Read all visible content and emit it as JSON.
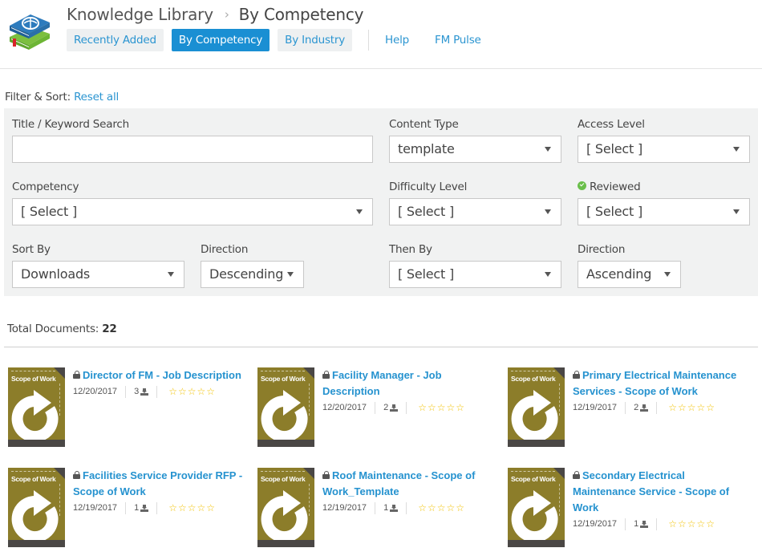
{
  "header": {
    "breadcrumb": [
      "Knowledge Library",
      "By Competency"
    ],
    "breadcrumb_separator": "›",
    "nav_tabs": [
      {
        "label": "Recently Added",
        "active": false
      },
      {
        "label": "By Competency",
        "active": true
      },
      {
        "label": "By Industry",
        "active": false
      }
    ],
    "nav_links": [
      "Help",
      "FM Pulse"
    ]
  },
  "filter": {
    "heading": "Filter & Sort:",
    "reset_label": "Reset all",
    "title_search": {
      "label": "Title / Keyword Search",
      "value": "",
      "placeholder": ""
    },
    "content_type": {
      "label": "Content Type",
      "value": "template"
    },
    "access_level": {
      "label": "Access Level",
      "value": "[ Select ]"
    },
    "competency": {
      "label": "Competency",
      "value": "[ Select ]"
    },
    "difficulty_level": {
      "label": "Difficulty Level",
      "value": "[ Select ]"
    },
    "reviewed": {
      "label": "Reviewed",
      "value": "[ Select ]"
    },
    "sort_by": {
      "label": "Sort By",
      "value": "Downloads"
    },
    "sort_direction": {
      "label": "Direction",
      "value": "Descending"
    },
    "then_by": {
      "label": "Then By",
      "value": "[ Select ]"
    },
    "then_direction": {
      "label": "Direction",
      "value": "Ascending"
    }
  },
  "results": {
    "total_label": "Total Documents:",
    "total_count": "22",
    "thumbnail_label": "Scope of Work",
    "documents": [
      {
        "title": "Director of FM - Job Description",
        "date": "12/20/2017",
        "downloads": "3",
        "rating": 0,
        "locked": true
      },
      {
        "title": "Facility Manager - Job Description",
        "date": "12/20/2017",
        "downloads": "2",
        "rating": 0,
        "locked": true
      },
      {
        "title": "Primary Electrical Maintenance Services - Scope of Work",
        "date": "12/19/2017",
        "downloads": "2",
        "rating": 0,
        "locked": true
      },
      {
        "title": "Facilities Service Provider RFP - Scope of Work",
        "date": "12/19/2017",
        "downloads": "1",
        "rating": 0,
        "locked": true
      },
      {
        "title": "Roof Maintenance - Scope of Work_Template",
        "date": "12/19/2017",
        "downloads": "1",
        "rating": 0,
        "locked": true
      },
      {
        "title": "Secondary Electrical Maintenance Service - Scope of Work",
        "date": "12/19/2017",
        "downloads": "1",
        "rating": 0,
        "locked": true
      }
    ]
  },
  "colors": {
    "accent": "#1a8fd3",
    "link": "#2592cf",
    "panel_bg": "#f1f2f2",
    "thumbnail": "#8c7d2a",
    "star": "#f2c200",
    "reviewed_check": "#6abf4b"
  }
}
